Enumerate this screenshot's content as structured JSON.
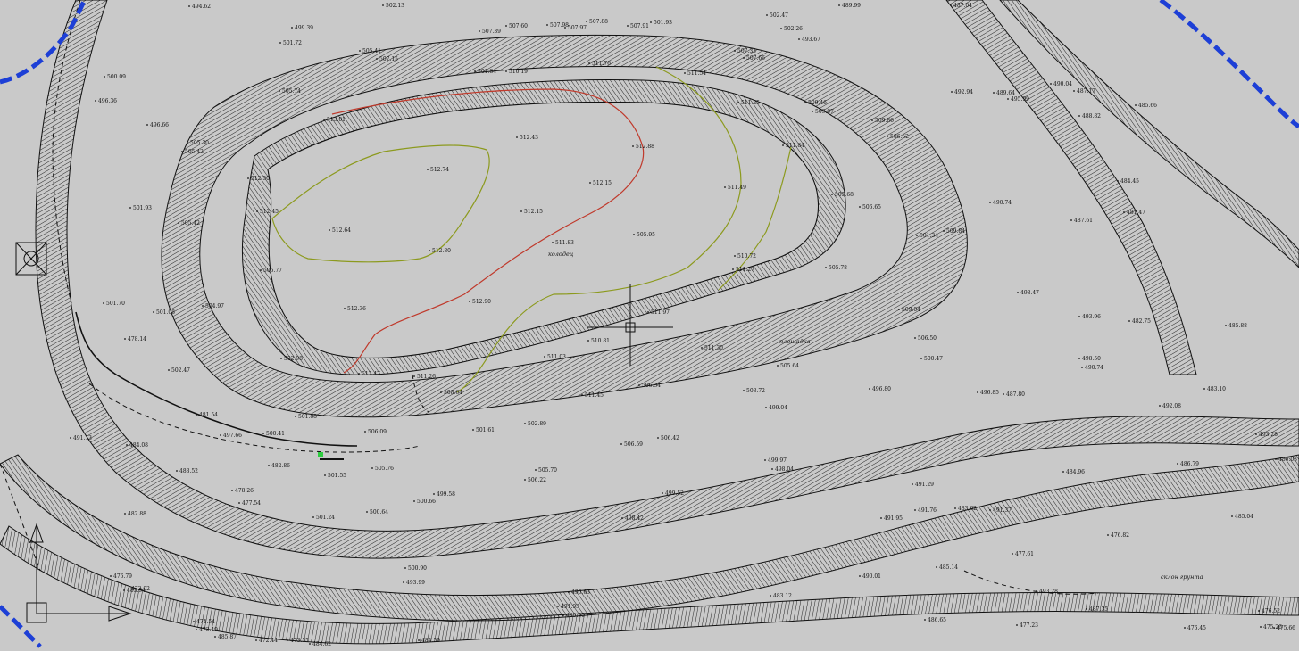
{
  "map": {
    "type": "topographic survey plan",
    "background": "#c9c9c9",
    "colors": {
      "linework": "#111111",
      "red_contour": "#c0392b",
      "olive_contour": "#8c9a1e",
      "boundary_blue": "#1d3fd6",
      "marker_green": "#2ecc40"
    },
    "contour_elevations": {
      "red": "512.5",
      "olive": "512.0"
    },
    "annotations": [
      {
        "text": "колодец"
      },
      {
        "text": "площадка"
      },
      {
        "text": "склон грунта"
      }
    ],
    "elevations": [
      "494.62",
      "502.13",
      "499.39",
      "501.72",
      "507.39",
      "507.60",
      "507.98",
      "507.97",
      "507.88",
      "507.91",
      "501.93",
      "502.47",
      "502.26",
      "493.67",
      "489.99",
      "487.04",
      "505.41",
      "507.15",
      "510.19",
      "501.84",
      "511.76",
      "507.33",
      "507.66",
      "511.54",
      "500.09",
      "496.36",
      "495.99",
      "487.17",
      "490.04",
      "496.66",
      "505.74",
      "513.01",
      "512.43",
      "512.88",
      "511.25",
      "509.46",
      "509.97",
      "509.86",
      "506.52",
      "492.94",
      "489.64",
      "488.82",
      "484.45",
      "485.66",
      "505.30",
      "505.42",
      "512.74",
      "512.15",
      "511.49",
      "511.84",
      "505.68",
      "506.65",
      "501.34",
      "490.74",
      "487.61",
      "481.47",
      "501.93",
      "505.42",
      "512.50",
      "512.45",
      "512.15",
      "512.64",
      "512.80",
      "511.83",
      "510.72",
      "505.95",
      "505.78",
      "509.84",
      "501.70",
      "501.08",
      "504.97",
      "505.77",
      "512.36",
      "512.90",
      "511.97",
      "511.27",
      "509.04",
      "506.50",
      "498.47",
      "493.96",
      "482.75",
      "485.88",
      "478.14",
      "502.47",
      "502.98",
      "512.47",
      "511.26",
      "511.03",
      "510.81",
      "511.30",
      "505.64",
      "500.47",
      "498.50",
      "492.08",
      "483.10",
      "481.54",
      "500.41",
      "501.88",
      "506.09",
      "508.64",
      "511.45",
      "506.34",
      "503.72",
      "496.80",
      "487.80",
      "490.74",
      "491.13",
      "484.08",
      "497.66",
      "501.61",
      "502.89",
      "506.59",
      "506.42",
      "499.04",
      "496.85",
      "493.28",
      "480.03",
      "483.52",
      "482.86",
      "501.55",
      "505.76",
      "505.70",
      "506.22",
      "499.97",
      "498.04",
      "491.29",
      "491.37",
      "486.79",
      "484.96",
      "485.04",
      "478.26",
      "477.54",
      "501.24",
      "500.64",
      "500.66",
      "499.58",
      "499.52",
      "498.42",
      "491.95",
      "491.76",
      "483.62",
      "482.88",
      "483.94",
      "500.90",
      "493.99",
      "490.63",
      "490.01",
      "485.14",
      "477.61",
      "476.82",
      "476.79",
      "473.02",
      "485.90",
      "491.93",
      "493.28",
      "487.35",
      "476.52",
      "475.66",
      "474.54",
      "473.49",
      "485.87",
      "484.62",
      "484.59",
      "483.12",
      "486.65",
      "477.23",
      "476.45",
      "475.26",
      "472.44",
      "473.55"
    ]
  }
}
